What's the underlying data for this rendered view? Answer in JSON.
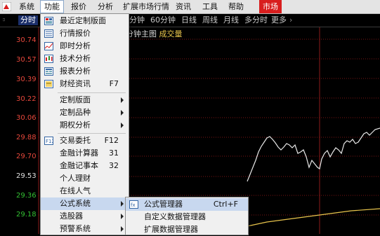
{
  "menubar": {
    "items": [
      {
        "label": "系统"
      },
      {
        "label": "功能"
      },
      {
        "label": "报价"
      },
      {
        "label": "分析"
      },
      {
        "label": "扩展市场行情"
      },
      {
        "label": "资讯"
      },
      {
        "label": "工具"
      },
      {
        "label": "帮助"
      },
      {
        "label": "市场"
      }
    ]
  },
  "toolbar": {
    "tab": "分时",
    "periods": [
      "分钟",
      "60分钟",
      "日线",
      "周线",
      "月线",
      "多分时",
      "更多"
    ],
    "more_arrow": "›"
  },
  "chart": {
    "subtitle": "5分钟主图",
    "volume_label": "成交量",
    "price_ticks": [
      {
        "label": "30.74",
        "color": "#e8483c"
      },
      {
        "label": "30.57",
        "color": "#e8483c"
      },
      {
        "label": "30.39",
        "color": "#e8483c"
      },
      {
        "label": "30.22",
        "color": "#e8483c"
      },
      {
        "label": "30.06",
        "color": "#e8483c"
      },
      {
        "label": "29.88",
        "color": "#e8483c"
      },
      {
        "label": "29.70",
        "color": "#e8483c"
      },
      {
        "label": "29.53",
        "color": "#e0e0e0"
      },
      {
        "label": "29.36",
        "color": "#33c233"
      },
      {
        "label": "29.18",
        "color": "#33c233"
      }
    ]
  },
  "dropdown": {
    "items": [
      {
        "icon": "layout-icon",
        "label": "最近定制版面",
        "shortcut": "",
        "submenu": false
      },
      {
        "icon": "quote-icon",
        "label": "行情报价",
        "shortcut": "",
        "submenu": false
      },
      {
        "icon": "timeline-icon",
        "label": "即时分析",
        "shortcut": "",
        "submenu": false
      },
      {
        "icon": "candlestick-icon",
        "label": "技术分析",
        "shortcut": "",
        "submenu": false
      },
      {
        "icon": "report-icon",
        "label": "报表分析",
        "shortcut": "",
        "submenu": false
      },
      {
        "icon": "finance-news-icon",
        "label": "财经资讯",
        "shortcut": "F7",
        "submenu": false
      },
      {
        "icon": "",
        "label": "定制版面",
        "shortcut": "",
        "submenu": true
      },
      {
        "icon": "",
        "label": "定制品种",
        "shortcut": "",
        "submenu": true
      },
      {
        "icon": "",
        "label": "期权分析",
        "shortcut": "",
        "submenu": true
      },
      {
        "icon": "trade-icon",
        "label": "交易委托",
        "shortcut": "F12",
        "submenu": false
      },
      {
        "icon": "",
        "label": "金融计算器",
        "shortcut": "31",
        "submenu": false
      },
      {
        "icon": "",
        "label": "金融记事本",
        "shortcut": "32",
        "submenu": false
      },
      {
        "icon": "",
        "label": "个人理财",
        "shortcut": "",
        "submenu": false
      },
      {
        "icon": "",
        "label": "在线人气",
        "shortcut": "",
        "submenu": false
      },
      {
        "icon": "",
        "label": "公式系统",
        "shortcut": "",
        "submenu": true
      },
      {
        "icon": "",
        "label": "选股器",
        "shortcut": "",
        "submenu": true
      },
      {
        "icon": "",
        "label": "预警系统",
        "shortcut": "",
        "submenu": true
      }
    ]
  },
  "submenu": {
    "items": [
      {
        "icon": "formula-icon",
        "label": "公式管理器",
        "shortcut": "Ctrl+F"
      },
      {
        "label": "自定义数据管理器",
        "shortcut": ""
      },
      {
        "label": "扩展数据管理器",
        "shortcut": ""
      }
    ]
  }
}
